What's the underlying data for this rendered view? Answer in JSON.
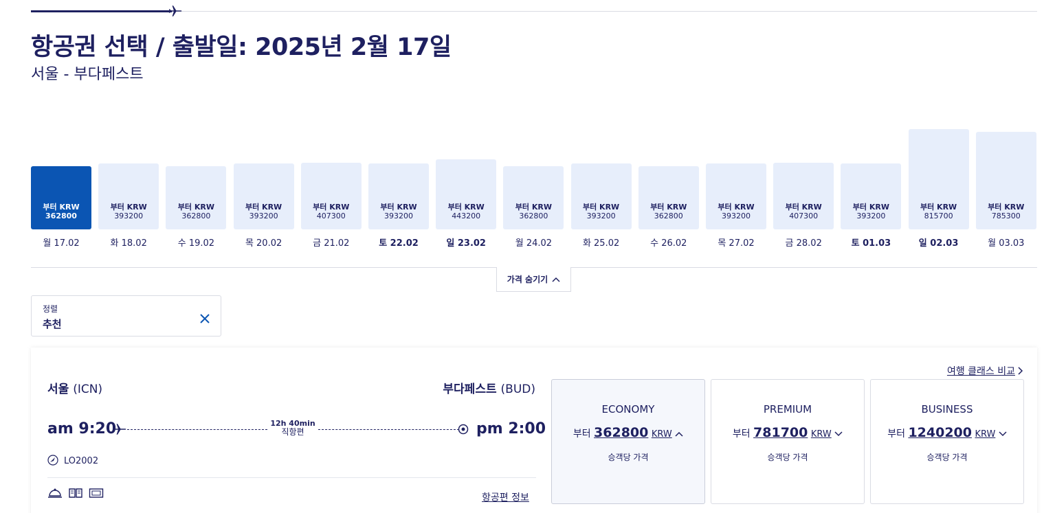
{
  "header": {
    "title": "항공권 선택 / 출발일: 2025년 2월 17일",
    "route": "서울 - 부다페스트"
  },
  "price_bars": {
    "prefix": "부터 KRW",
    "items": [
      {
        "price": "362800",
        "date": "월 17.02",
        "selected": true,
        "bold": false
      },
      {
        "price": "393200",
        "date": "화 18.02",
        "selected": false,
        "bold": false
      },
      {
        "price": "362800",
        "date": "수 19.02",
        "selected": false,
        "bold": false
      },
      {
        "price": "393200",
        "date": "목 20.02",
        "selected": false,
        "bold": false
      },
      {
        "price": "407300",
        "date": "금 21.02",
        "selected": false,
        "bold": false
      },
      {
        "price": "393200",
        "date": "토 22.02",
        "selected": false,
        "bold": true
      },
      {
        "price": "443200",
        "date": "일 23.02",
        "selected": false,
        "bold": true
      },
      {
        "price": "362800",
        "date": "월 24.02",
        "selected": false,
        "bold": false
      },
      {
        "price": "393200",
        "date": "화 25.02",
        "selected": false,
        "bold": false
      },
      {
        "price": "362800",
        "date": "수 26.02",
        "selected": false,
        "bold": false
      },
      {
        "price": "393200",
        "date": "목 27.02",
        "selected": false,
        "bold": false
      },
      {
        "price": "407300",
        "date": "금 28.02",
        "selected": false,
        "bold": false
      },
      {
        "price": "393200",
        "date": "토 01.03",
        "selected": false,
        "bold": true
      },
      {
        "price": "815700",
        "date": "일 02.03",
        "selected": false,
        "bold": true
      },
      {
        "price": "785300",
        "date": "월 03.03",
        "selected": false,
        "bold": false
      }
    ],
    "hide_label": "가격 숨기기"
  },
  "sort": {
    "label": "정렬",
    "value": "추천"
  },
  "flight": {
    "origin_city": "서울",
    "origin_code": "(ICN)",
    "dest_city": "부다페스트",
    "dest_code": "(BUD)",
    "departure": "am 9:20",
    "arrival": "pm 2:00",
    "duration": "12h 40min",
    "direct": "직항편",
    "flight_number": "LO2002",
    "info_link": "항공편 정보"
  },
  "fares": {
    "compare_link": "여행 클래스 비교",
    "prefix": "부터",
    "currency": "KRW",
    "note": "승객당 가격",
    "classes": [
      {
        "name": "ECONOMY",
        "price": "362800",
        "active": true
      },
      {
        "name": "PREMIUM",
        "price": "781700",
        "active": false
      },
      {
        "name": "BUSINESS",
        "price": "1240200",
        "active": false
      }
    ]
  },
  "colors": {
    "navy": "#1e2060",
    "accent_blue": "#0b55b3",
    "bar_light": "#e7eefb"
  }
}
